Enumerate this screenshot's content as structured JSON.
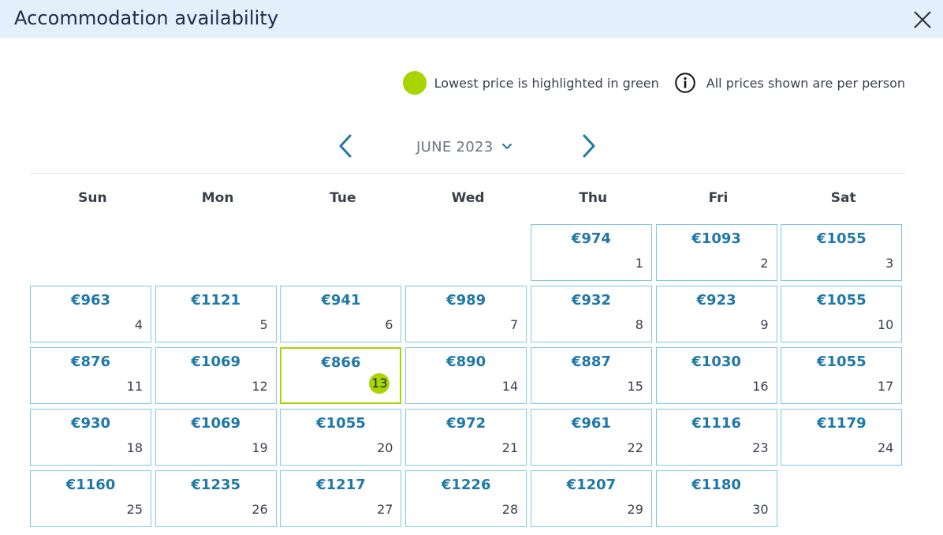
{
  "header": {
    "title": "Accommodation availability",
    "close_icon": "close-icon"
  },
  "legend": {
    "lowest_text": "Lowest price is highlighted in green",
    "per_person_text": "All prices shown are per person",
    "lowest_color": "#a8d400"
  },
  "calendar": {
    "month_label": "JUNE 2023",
    "weekdays": [
      "Sun",
      "Mon",
      "Tue",
      "Wed",
      "Thu",
      "Fri",
      "Sat"
    ],
    "weeks": [
      [
        null,
        null,
        null,
        null,
        {
          "price": "€974",
          "date": "1"
        },
        {
          "price": "€1093",
          "date": "2"
        },
        {
          "price": "€1055",
          "date": "3"
        }
      ],
      [
        {
          "price": "€963",
          "date": "4"
        },
        {
          "price": "€1121",
          "date": "5"
        },
        {
          "price": "€941",
          "date": "6"
        },
        {
          "price": "€989",
          "date": "7"
        },
        {
          "price": "€932",
          "date": "8"
        },
        {
          "price": "€923",
          "date": "9"
        },
        {
          "price": "€1055",
          "date": "10"
        }
      ],
      [
        {
          "price": "€876",
          "date": "11"
        },
        {
          "price": "€1069",
          "date": "12"
        },
        {
          "price": "€866",
          "date": "13",
          "lowest": true
        },
        {
          "price": "€890",
          "date": "14"
        },
        {
          "price": "€887",
          "date": "15"
        },
        {
          "price": "€1030",
          "date": "16"
        },
        {
          "price": "€1055",
          "date": "17"
        }
      ],
      [
        {
          "price": "€930",
          "date": "18"
        },
        {
          "price": "€1069",
          "date": "19"
        },
        {
          "price": "€1055",
          "date": "20"
        },
        {
          "price": "€972",
          "date": "21"
        },
        {
          "price": "€961",
          "date": "22"
        },
        {
          "price": "€1116",
          "date": "23"
        },
        {
          "price": "€1179",
          "date": "24"
        }
      ],
      [
        {
          "price": "€1160",
          "date": "25"
        },
        {
          "price": "€1235",
          "date": "26"
        },
        {
          "price": "€1217",
          "date": "27"
        },
        {
          "price": "€1226",
          "date": "28"
        },
        {
          "price": "€1207",
          "date": "29"
        },
        {
          "price": "€1180",
          "date": "30"
        },
        null
      ]
    ]
  },
  "colors": {
    "accent": "#1f78a8",
    "border": "#7fc9e4",
    "header_bg": "#e3f0fb",
    "lowest": "#a8d400"
  }
}
